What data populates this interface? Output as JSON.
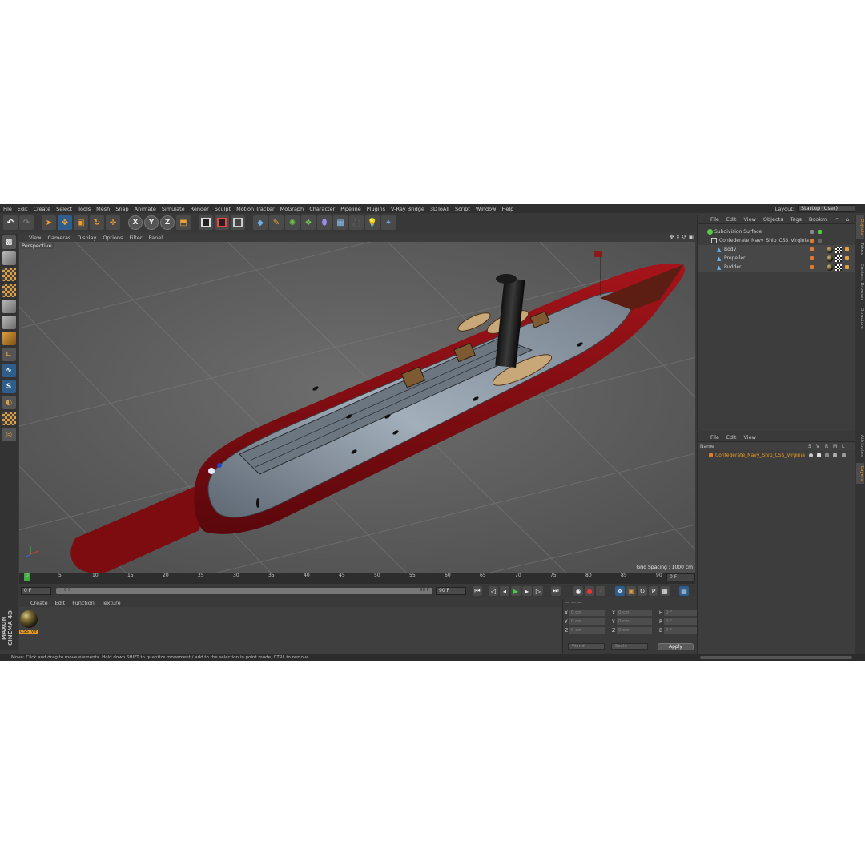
{
  "menubar": {
    "items": [
      "File",
      "Edit",
      "Create",
      "Select",
      "Tools",
      "Mesh",
      "Snap",
      "Animate",
      "Simulate",
      "Render",
      "Sculpt",
      "Motion Tracker",
      "MoGraph",
      "Character",
      "Pipeline",
      "Plugins",
      "V-Ray Bridge",
      "3DToAll",
      "Script",
      "Window",
      "Help"
    ],
    "layout_label": "Layout:",
    "layout_value": "Startup (User)"
  },
  "toolbar": {
    "axis_x": "X",
    "axis_y": "Y",
    "axis_z": "Z"
  },
  "viewport": {
    "menu": [
      "View",
      "Cameras",
      "Display",
      "Options",
      "Filter",
      "Panel"
    ],
    "camera_label": "Perspective",
    "grid_spacing": "Grid Spacing : 1000 cm",
    "background_color": "#5f5f5f",
    "hull_color": "#8a0d12",
    "deck_color": "#8f9aa6"
  },
  "timeline": {
    "ticks": [
      "0",
      "5",
      "10",
      "15",
      "20",
      "25",
      "30",
      "35",
      "40",
      "45",
      "50",
      "55",
      "60",
      "65",
      "70",
      "75",
      "80",
      "85",
      "90"
    ],
    "current_frame": "0 F",
    "start_field": "0 F",
    "range_start": "0 F",
    "range_end": "90 F",
    "end_field": "90 F"
  },
  "material_manager": {
    "menu": [
      "Create",
      "Edit",
      "Function",
      "Texture"
    ],
    "material_name": "CSS_Vir"
  },
  "coordinates": {
    "rows": [
      {
        "a": "X",
        "av": "0 cm",
        "b": "X",
        "bv": "0 cm",
        "c": "H",
        "cv": "0 °"
      },
      {
        "a": "Y",
        "av": "0 cm",
        "b": "Y",
        "bv": "0 cm",
        "c": "P",
        "cv": "0 °"
      },
      {
        "a": "Z",
        "av": "0 cm",
        "b": "Z",
        "bv": "0 cm",
        "c": "B",
        "cv": "0 °"
      }
    ],
    "mode1": "World",
    "mode2": "Scale",
    "apply": "Apply"
  },
  "object_manager": {
    "menu": [
      "File",
      "Edit",
      "View",
      "Objects",
      "Tags",
      "Bookm"
    ],
    "objects": [
      {
        "name": "Subdivision Surface",
        "indent": 0
      },
      {
        "name": "Confederate_Navy_Ship_CSS_Virginia",
        "indent": 1
      },
      {
        "name": "Body",
        "indent": 2
      },
      {
        "name": "Propeller",
        "indent": 2
      },
      {
        "name": "Rudder",
        "indent": 2
      }
    ]
  },
  "layer_manager": {
    "menu": [
      "File",
      "Edit",
      "View"
    ],
    "col_name": "Name",
    "col_s": "S",
    "col_v": "V",
    "col_r": "R",
    "col_m": "M",
    "col_l": "L",
    "layer_name": "Confederate_Navy_Ship_CSS_Virginia"
  },
  "right_tabs": [
    "Objects",
    "Takes",
    "Content Browser",
    "Structure",
    "Attributes",
    "Layers"
  ],
  "branding": "MAXON CINEMA 4D",
  "status": "Move: Click and drag to move elements. Hold down SHIFT to quantize movement / add to the selection in point mode, CTRL to remove.",
  "colors": {
    "accent_orange": "#e69a22",
    "select_blue": "#2f5d8c"
  }
}
